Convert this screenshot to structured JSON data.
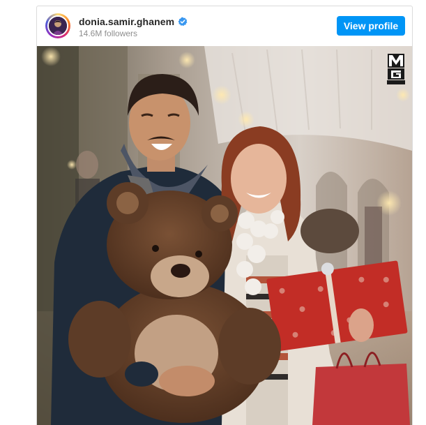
{
  "post": {
    "username": "donia.samir.ghanem",
    "followers": "14.6M followers",
    "view_profile_label": "View profile",
    "verified_icon": "verified-badge-icon",
    "colors": {
      "button": "#0095f6",
      "verified": "#3897f0",
      "username": "#262626",
      "muted": "#8e8e8e"
    }
  },
  "photo": {
    "description_icon": "photo-image",
    "watermark_icon": "mg-pexel-logo-icon"
  }
}
